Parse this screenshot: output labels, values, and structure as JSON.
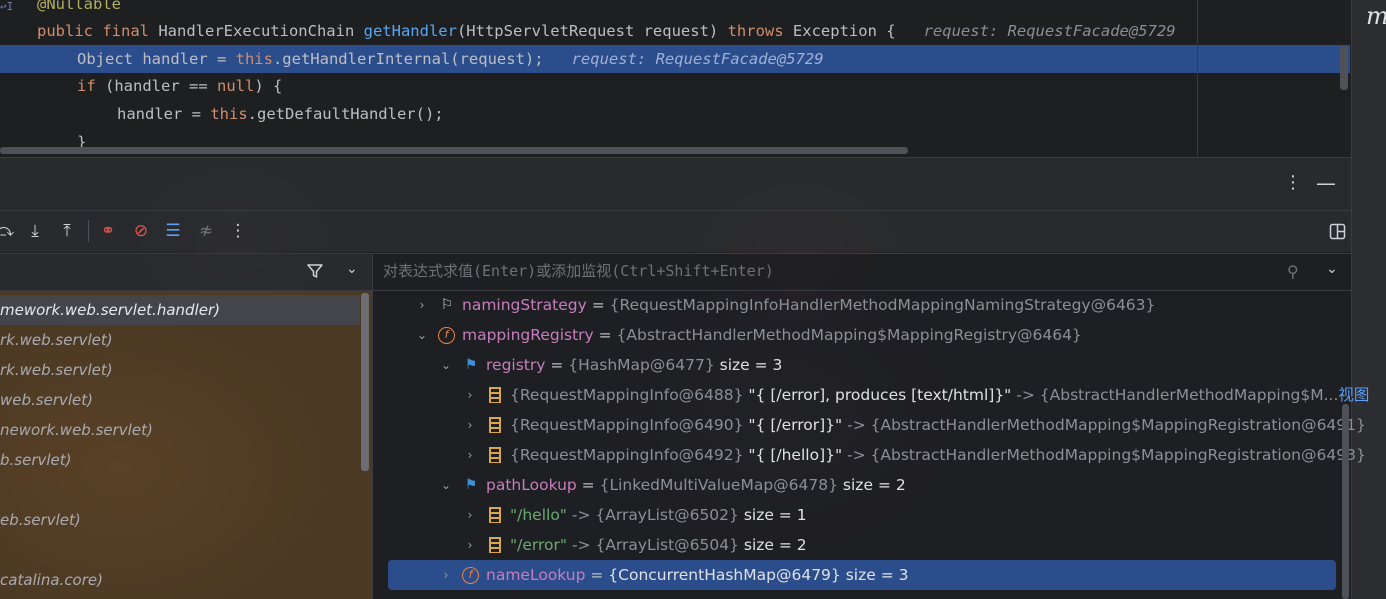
{
  "editor": {
    "lines": [
      {
        "segments": [
          {
            "t": "@Nullable",
            "c": "ann"
          }
        ]
      },
      {
        "segments": [
          {
            "t": "public final ",
            "c": "kw"
          },
          {
            "t": "HandlerExecutionChain ",
            "c": ""
          },
          {
            "t": "getHandler",
            "c": "fn"
          },
          {
            "t": "(HttpServletRequest request) ",
            "c": ""
          },
          {
            "t": "throws ",
            "c": "kw"
          },
          {
            "t": "Exception {",
            "c": ""
          },
          {
            "t": "   request: RequestFacade@5729",
            "c": "hint"
          }
        ]
      },
      {
        "segments": [
          {
            "t": "Object handler = ",
            "c": ""
          },
          {
            "t": "this",
            "c": "kw"
          },
          {
            "t": ".getHandlerInternal(request);",
            "c": ""
          },
          {
            "t": "   request: RequestFacade@5729",
            "c": "hint"
          }
        ]
      },
      {
        "segments": [
          {
            "t": "if ",
            "c": "kw"
          },
          {
            "t": "(handler == ",
            "c": ""
          },
          {
            "t": "null",
            "c": "kw"
          },
          {
            "t": ") {",
            "c": ""
          }
        ]
      },
      {
        "segments": [
          {
            "t": "handler = ",
            "c": ""
          },
          {
            "t": "this",
            "c": "kw"
          },
          {
            "t": ".getDefaultHandler();",
            "c": ""
          }
        ]
      },
      {
        "segments": [
          {
            "t": "}",
            "c": ""
          }
        ]
      }
    ]
  },
  "right_strip": {
    "letter": "m"
  },
  "panel_header": {
    "more_icon": "vertical-dots-icon",
    "minimize_icon": "minimize-icon"
  },
  "toolbar": {
    "buttons": [
      {
        "name": "step-over-icon",
        "glyph": "⤼",
        "color": "#cfd1d6"
      },
      {
        "name": "step-into-icon",
        "glyph": "⤓",
        "color": "#cfd1d6"
      },
      {
        "name": "step-out-icon",
        "glyph": "⤒",
        "color": "#cfd1d6"
      },
      {
        "name": "view-breakpoints-icon",
        "glyph": "⚭",
        "color": "#e0584b"
      },
      {
        "name": "mute-breakpoints-icon",
        "glyph": "⊘",
        "color": "#e0584b"
      },
      {
        "name": "evaluate-icon",
        "glyph": "☰",
        "color": "#5e9ef5"
      },
      {
        "name": "trace-icon",
        "glyph": "≉",
        "color": "#6f7177"
      },
      {
        "name": "more-icon",
        "glyph": "⋮",
        "color": "#cfd1d6"
      }
    ],
    "layout_icon": "layout-icon"
  },
  "frames": {
    "items": [
      "mework.web.servlet.handler)",
      "rk.web.servlet)",
      "rk.web.servlet)",
      "web.servlet)",
      "nework.web.servlet)",
      "b.servlet)",
      "",
      "eb.servlet)",
      "",
      "catalina.core)"
    ]
  },
  "eval": {
    "placeholder": "对表达式求值(Enter)或添加监视(Ctrl+Shift+Enter)"
  },
  "variables": [
    {
      "depth": 0,
      "chevron": "›",
      "icon": "watch",
      "name": "namingStrategy",
      "type": "{RequestMappingInfoHandlerMethodMappingNamingStrategy@6463}",
      "rest": ""
    },
    {
      "depth": 0,
      "chevron": "⌄",
      "icon": "field",
      "name": "mappingRegistry",
      "type": "{AbstractHandlerMethodMapping$MappingRegistry@6464}",
      "rest": ""
    },
    {
      "depth": 1,
      "chevron": "⌄",
      "icon": "flag",
      "name": "registry",
      "type": "{HashMap@6477}",
      "rest": "size = 3"
    },
    {
      "depth": 2,
      "chevron": "›",
      "icon": "entry",
      "key": "{RequestMappingInfo@6488}",
      "val": "\"{ [/error], produces [text/html]}\"",
      "arrow": " -> ",
      "target": "{AbstractHandlerMethodMapping$M...",
      "link": "视图"
    },
    {
      "depth": 2,
      "chevron": "›",
      "icon": "entry",
      "key": "{RequestMappingInfo@6490}",
      "val": "\"{ [/error]}\"",
      "arrow": " -> ",
      "target": "{AbstractHandlerMethodMapping$MappingRegistration@6491}",
      "link": ""
    },
    {
      "depth": 2,
      "chevron": "›",
      "icon": "entry",
      "key": "{RequestMappingInfo@6492}",
      "val": "\"{ [/hello]}\"",
      "arrow": " -> ",
      "target": "{AbstractHandlerMethodMapping$MappingRegistration@6493}",
      "link": ""
    },
    {
      "depth": 1,
      "chevron": "⌄",
      "icon": "flag",
      "name": "pathLookup",
      "type": "{LinkedMultiValueMap@6478}",
      "rest": "size = 2"
    },
    {
      "depth": 2,
      "chevron": "›",
      "icon": "entry",
      "str": "\"/hello\"",
      "arrow": " -> ",
      "target": "{ArrayList@6502}",
      "rest": "size = 1"
    },
    {
      "depth": 2,
      "chevron": "›",
      "icon": "entry",
      "str": "\"/error\"",
      "arrow": " -> ",
      "target": "{ArrayList@6504}",
      "rest": "size = 2"
    },
    {
      "depth": 1,
      "chevron": "›",
      "icon": "field",
      "name": "nameLookup",
      "type": "{ConcurrentHashMap@6479}",
      "rest": "size = 3",
      "selected": true
    }
  ]
}
